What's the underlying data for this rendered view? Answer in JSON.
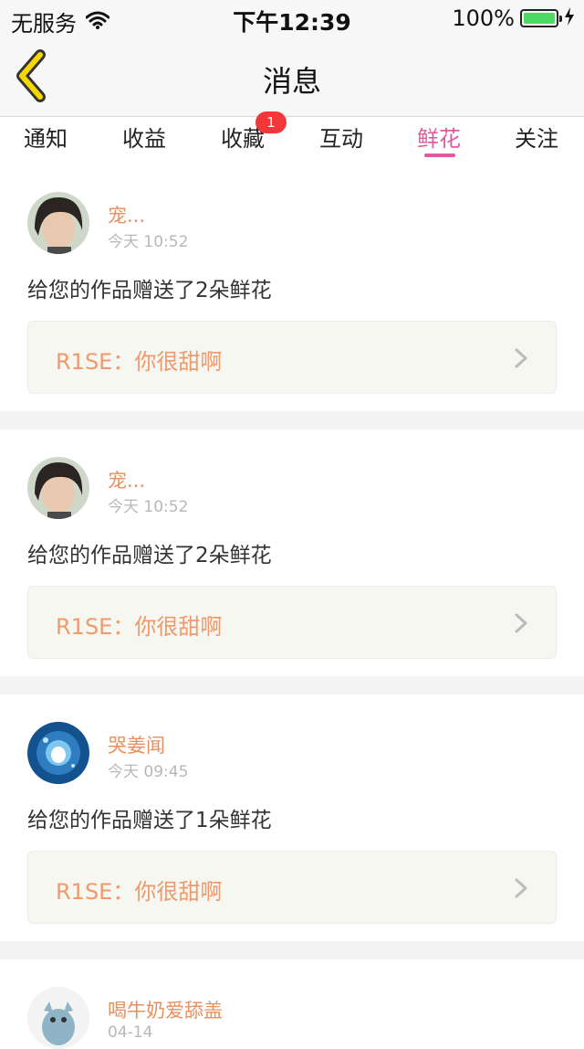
{
  "status_bar": {
    "carrier": "无服务",
    "time": "下午12:39",
    "battery": "100%"
  },
  "nav": {
    "title": "消息"
  },
  "tabs": [
    {
      "label": "通知"
    },
    {
      "label": "收益"
    },
    {
      "label": "收藏",
      "badge": "1"
    },
    {
      "label": "互动"
    },
    {
      "label": "鲜花",
      "active": true
    },
    {
      "label": "关注"
    }
  ],
  "messages": [
    {
      "name": "宠...",
      "time": "今天 10:52",
      "text": "给您的作品赠送了2朵鲜花",
      "quote": "R1SE：你很甜啊"
    },
    {
      "name": "宠...",
      "time": "今天 10:52",
      "text": "给您的作品赠送了2朵鲜花",
      "quote": "R1SE：你很甜啊"
    },
    {
      "name": "哭姜闻",
      "time": "今天 09:45",
      "text": "给您的作品赠送了1朵鲜花",
      "quote": "R1SE：你很甜啊"
    },
    {
      "name": "喝牛奶爱舔盖",
      "time": "04-14"
    }
  ],
  "colors": {
    "accent": "#e05aa0",
    "name": "#e88f5f",
    "quote_text": "#ef9a6c",
    "badge": "#f2373b",
    "back_arrow": "#f5d800"
  }
}
